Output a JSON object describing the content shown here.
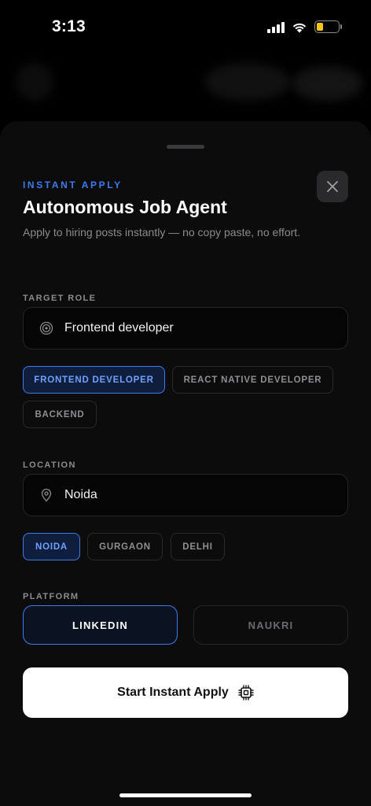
{
  "status": {
    "time": "3:13"
  },
  "sheet": {
    "eyebrow": "INSTANT APPLY",
    "title": "Autonomous Job Agent",
    "subtitle": "Apply to hiring posts instantly — no copy paste, no effort."
  },
  "target_role": {
    "label": "TARGET ROLE",
    "value": "Frontend developer",
    "icon": "target-icon",
    "chips": [
      {
        "label": "FRONTEND DEVELOPER",
        "active": true
      },
      {
        "label": "REACT NATIVE DEVELOPER",
        "active": false
      },
      {
        "label": "BACKEND",
        "active": false
      }
    ]
  },
  "location": {
    "label": "LOCATION",
    "value": "Noida",
    "icon": "map-pin-icon",
    "chips": [
      {
        "label": "NOIDA",
        "active": true
      },
      {
        "label": "GURGAON",
        "active": false
      },
      {
        "label": "DELHI",
        "active": false
      }
    ]
  },
  "platform": {
    "label": "PLATFORM",
    "options": [
      {
        "label": "LINKEDIN",
        "active": true
      },
      {
        "label": "NAUKRI",
        "active": false
      }
    ]
  },
  "cta": {
    "label": "Start Instant Apply",
    "icon": "chip-icon"
  },
  "colors": {
    "accent": "#3d7bf0",
    "sheet_bg": "#0c0c0d",
    "battery": "#f5c518"
  }
}
